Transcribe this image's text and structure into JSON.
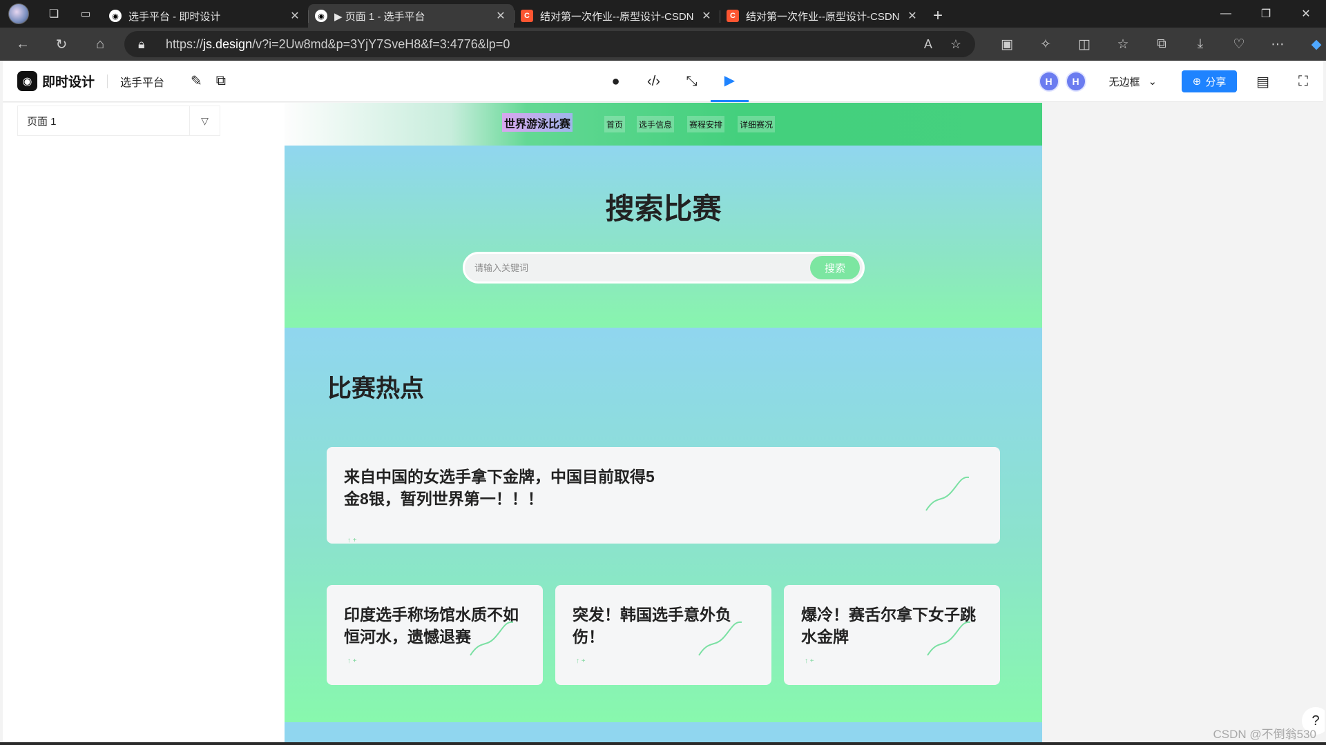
{
  "browser": {
    "tabs": [
      {
        "title": "选手平台 - 即时设计",
        "icon": "jsdesign-icon"
      },
      {
        "title": "▶ 页面 1 - 选手平台",
        "icon": "jsdesign-icon"
      },
      {
        "title": "结对第一次作业--原型设计-CSDN",
        "icon": "csdn-icon"
      },
      {
        "title": "结对第一次作业--原型设计-CSDN",
        "icon": "csdn-icon"
      }
    ],
    "url_prefix": "https://",
    "url_domain": "js.design",
    "url_rest": "/v?i=2Uw8md&p=3YjY7SveH8&f=3:4776&lp=0"
  },
  "app": {
    "brand": "即时设计",
    "project_name": "选手平台",
    "avatars": [
      "H",
      "H"
    ],
    "frame_mode": "无边框",
    "share_label": "分享",
    "accent": "#1e83ff"
  },
  "left_panel": {
    "page_selector": "页面 1"
  },
  "prototype": {
    "logo": "世界游泳比赛",
    "nav_links": [
      "首页",
      "选手信息",
      "赛程安排",
      "详细赛况"
    ],
    "hero_title": "搜索比赛",
    "search_placeholder": "请输入关键词",
    "search_button": "搜索",
    "section_title": "比赛热点",
    "featured_card": {
      "title_line1": "来自中国的女选手拿下金牌，中国目前取得5",
      "title_line2": "金8银，暂列世界第一！！！"
    },
    "cards": [
      {
        "line1": "印度选手称场馆水质不如",
        "line2": "恒河水，遗憾退赛"
      },
      {
        "line1": "突发！韩国选手意外负",
        "line2": "伤！"
      },
      {
        "line1": "爆冷！赛舌尔拿下女子跳",
        "line2": "水金牌"
      }
    ],
    "card_tag": "↑ +",
    "colors": {
      "nav_green": "#44d07d",
      "hero_top": "#90d6ef",
      "hero_bottom": "#88f5ad",
      "search_button": "#7ce6a1"
    }
  },
  "help_label": "?",
  "watermark": "CSDN @不倒翁530"
}
